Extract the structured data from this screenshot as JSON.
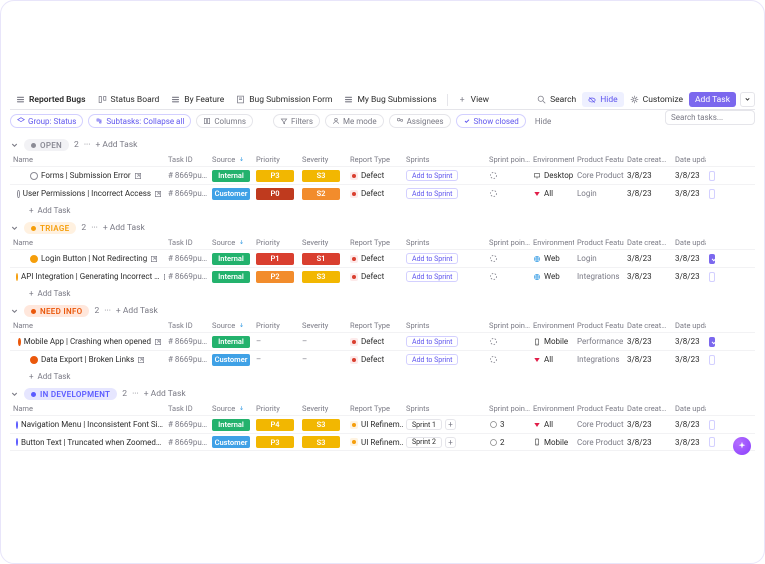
{
  "tabs": {
    "reported": "Reported Bugs",
    "status": "Status Board",
    "feature": "By Feature",
    "form": "Bug Submission Form",
    "mysubs": "My Bug Submissions",
    "view": "View",
    "search": "Search",
    "hide": "Hide",
    "customize": "Customize",
    "addtask": "Add Task"
  },
  "filters": {
    "group": "Group: Status",
    "subtasks": "Subtasks: Collapse all",
    "columns": "Columns",
    "filters": "Filters",
    "memode": "Me mode",
    "assignees": "Assignees",
    "showclosed": "Show closed",
    "hide": "Hide"
  },
  "search_placeholder": "Search tasks...",
  "headers": {
    "name": "Name",
    "taskid": "Task ID",
    "source": "Source",
    "priority": "Priority",
    "severity": "Severity",
    "report": "Report Type",
    "sprints": "Sprints",
    "sprintp": "Sprint poin…",
    "env": "Environment",
    "feature": "Product Feature",
    "created": "Date creat…",
    "updated": "Date upda…"
  },
  "badges": {
    "internal": "Internal",
    "customer": "Customer",
    "P0": "P0",
    "P1": "P1",
    "P2": "P2",
    "P3": "P3",
    "S1": "S1",
    "S2": "S2",
    "S3": "S3",
    "defect": "Defect",
    "uirefine": "UI Refinem…"
  },
  "sprint_actions": {
    "add": "Add to Sprint",
    "sprint1": "Sprint 1",
    "sprint2": "Sprint 2"
  },
  "env": {
    "all": "All",
    "web": "Web",
    "mobile": "Mobile",
    "desktop": "Desktop"
  },
  "feat": {
    "core": "Core Product",
    "login": "Login",
    "integrations": "Integrations",
    "performance": "Performance"
  },
  "dates": {
    "d": "3/8/23"
  },
  "labels": {
    "addtask": "Add Task"
  },
  "sections": [
    {
      "key": "open",
      "label": "OPEN",
      "count": "2"
    },
    {
      "key": "triage",
      "label": "TRIAGE",
      "count": "2"
    },
    {
      "key": "need",
      "label": "NEED INFO",
      "count": "2"
    },
    {
      "key": "dev",
      "label": "IN DEVELOPMENT",
      "count": "2"
    }
  ],
  "rows": {
    "open": [
      {
        "name": "Forms | Submission Error",
        "id": "# 8669pu…",
        "source": "Internal",
        "priority": "P3",
        "severity": "S3",
        "report": "Defect",
        "sprint": "add",
        "points": "",
        "env": "Desktop",
        "feature": "Core Product",
        "created": "3/8/23",
        "updated": "3/8/23",
        "checked": false
      },
      {
        "name": "User Permissions | Incorrect Access",
        "id": "# 8669pu…",
        "source": "Customer",
        "priority": "P0",
        "severity": "S2",
        "report": "Defect",
        "sprint": "add",
        "points": "",
        "env": "All",
        "feature": "Login",
        "created": "3/8/23",
        "updated": "3/8/23",
        "checked": false
      }
    ],
    "triage": [
      {
        "name": "Login Button | Not Redirecting",
        "id": "# 8669pu…",
        "source": "Internal",
        "priority": "P1",
        "severity": "S1",
        "report": "Defect",
        "sprint": "add",
        "points": "",
        "env": "Web",
        "feature": "Login",
        "created": "3/8/23",
        "updated": "3/8/23",
        "checked": true
      },
      {
        "name": "API Integration | Generating Incorrect …",
        "id": "# 8669pu…",
        "source": "Internal",
        "priority": "P2",
        "severity": "S3",
        "report": "Defect",
        "sprint": "add",
        "points": "",
        "env": "Web",
        "feature": "Integrations",
        "created": "3/8/23",
        "updated": "3/8/23",
        "checked": false
      }
    ],
    "need": [
      {
        "name": "Mobile App | Crashing when opened",
        "id": "# 8669pu…",
        "source": "Internal",
        "priority": "-",
        "severity": "-",
        "report": "Defect",
        "sprint": "add",
        "points": "",
        "env": "Mobile",
        "feature": "Performance",
        "created": "3/8/23",
        "updated": "3/8/23",
        "checked": true
      },
      {
        "name": "Data Export | Broken Links",
        "id": "# 8669pu…",
        "source": "Customer",
        "priority": "-",
        "severity": "-",
        "report": "Defect",
        "sprint": "add",
        "points": "",
        "env": "All",
        "feature": "Integrations",
        "created": "3/8/23",
        "updated": "3/8/23",
        "checked": false
      }
    ],
    "dev": [
      {
        "name": "Navigation Menu | Inconsistent Font Si…",
        "id": "# 8669pu…",
        "source": "Internal",
        "priority": "P4",
        "severity": "S3",
        "report": "UI Refinem…",
        "sprint": "sprint1",
        "points": "3",
        "env": "All",
        "feature": "Core Product",
        "created": "3/8/23",
        "updated": "3/8/23",
        "checked": false
      },
      {
        "name": "Button Text | Truncated when Zoomed…",
        "id": "# 8669pu…",
        "source": "Customer",
        "priority": "P3",
        "severity": "S3",
        "report": "UI Refinem…",
        "sprint": "sprint2",
        "points": "2",
        "env": "Mobile",
        "feature": "Core Product",
        "created": "3/8/23",
        "updated": "3/8/23",
        "checked": false
      }
    ]
  }
}
